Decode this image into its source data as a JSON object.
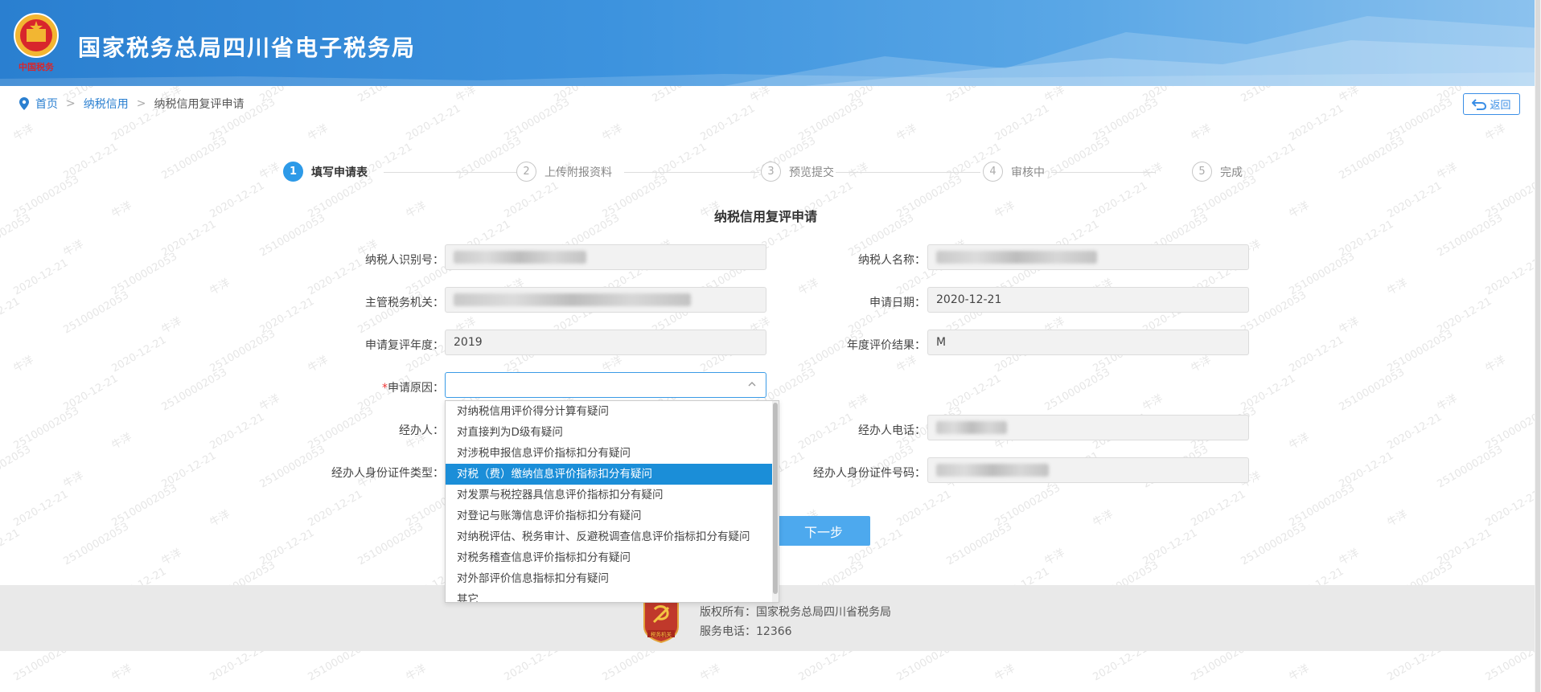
{
  "header": {
    "site_title": "国家税务总局四川省电子税务局",
    "logo_text": "中国税务"
  },
  "breadcrumb": {
    "home": "首页",
    "credit": "纳税信用",
    "current": "纳税信用复评申请",
    "separator": ">"
  },
  "back_button": "返回",
  "steps": [
    {
      "num": "1",
      "label": "填写申请表",
      "active": true
    },
    {
      "num": "2",
      "label": "上传附报资料",
      "active": false
    },
    {
      "num": "3",
      "label": "预览提交",
      "active": false
    },
    {
      "num": "4",
      "label": "审核中",
      "active": false
    },
    {
      "num": "5",
      "label": "完成",
      "active": false
    }
  ],
  "form": {
    "title": "纳税信用复评申请",
    "taxpayer_id_label": "纳税人识别号：",
    "taxpayer_name_label": "纳税人名称：",
    "tax_authority_label": "主管税务机关：",
    "apply_date_label": "申请日期：",
    "apply_date_value": "2020-12-21",
    "review_year_label": "申请复评年度：",
    "review_year_value": "2019",
    "annual_result_label": "年度评价结果：",
    "annual_result_value": "M",
    "reason_required_mark": "*",
    "reason_label": "申请原因：",
    "handler_label": "经办人：",
    "handler_phone_label": "经办人电话：",
    "handler_id_type_label": "经办人身份证件类型：",
    "handler_id_no_label": "经办人身份证件号码：",
    "next_button": "下一步"
  },
  "reason_options": [
    "对纳税信用评价得分计算有疑问",
    "对直接判为D级有疑问",
    "对涉税申报信息评价指标扣分有疑问",
    "对税（费）缴纳信息评价指标扣分有疑问",
    "对发票与税控器具信息评价指标扣分有疑问",
    "对登记与账簿信息评价指标扣分有疑问",
    "对纳税评估、税务审计、反避税调查信息评价指标扣分有疑问",
    "对税务稽查信息评价指标扣分有疑问",
    "对外部评价信息指标扣分有疑问",
    "其它"
  ],
  "selected_option_index": 3,
  "footer": {
    "copyright": "版权所有：国家税务总局四川省税务局",
    "phone": "服务电话：12366",
    "emblem_text": "税务机关"
  },
  "watermark": {
    "id": "2510000205З",
    "name": "牛洋",
    "date": "2020-12-21"
  },
  "colors": {
    "header_blue": "#2a7fd0",
    "accent": "#2d9ae8",
    "selected": "#1b8ed8",
    "required": "#e33333"
  }
}
